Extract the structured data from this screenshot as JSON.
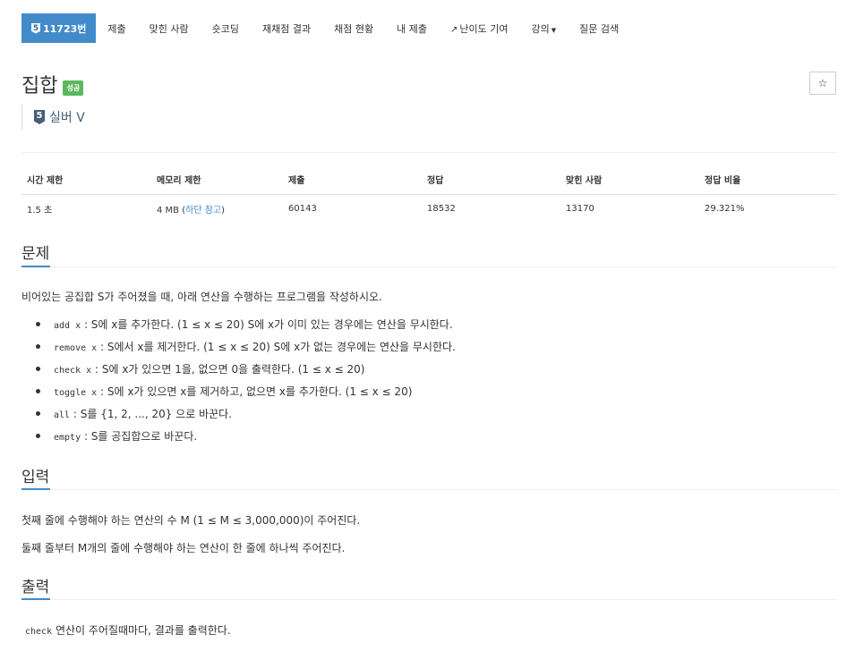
{
  "nav": {
    "problem_id": "11723번",
    "items": [
      "제출",
      "맞힌 사람",
      "숏코딩",
      "재채점 결과",
      "채점 현황",
      "내 제출",
      "난이도 기여",
      "강의",
      "질문 검색"
    ]
  },
  "problem": {
    "title": "집합",
    "status_badge": "성공",
    "tier": "실버 V",
    "tier_number": "5",
    "star": "☆"
  },
  "info_table": {
    "headers": [
      "시간 제한",
      "메모리 제한",
      "제출",
      "정답",
      "맞힌 사람",
      "정답 비율"
    ],
    "time_limit": "1.5 초",
    "memory_limit": "4 MB",
    "memory_note": "하단 참고",
    "submissions": "60143",
    "accepted": "18532",
    "solvers": "13170",
    "ratio": "29.321%"
  },
  "sections": {
    "description_title": "문제",
    "description_intro": "비어있는 공집합 S가 주어졌을 때, 아래 연산을 수행하는 프로그램을 작성하시오.",
    "operations": [
      {
        "code": "add x",
        "text": ": S에 x를 추가한다. (1 ≤ x ≤ 20) S에 x가 이미 있는 경우에는 연산을 무시한다."
      },
      {
        "code": "remove x",
        "text": ": S에서 x를 제거한다. (1 ≤ x ≤ 20) S에 x가 없는 경우에는 연산을 무시한다."
      },
      {
        "code": "check x",
        "text": ": S에 x가 있으면 1을, 없으면 0을 출력한다. (1 ≤ x ≤ 20)"
      },
      {
        "code": "toggle x",
        "text": ": S에 x가 있으면 x를 제거하고, 없으면 x를 추가한다. (1 ≤ x ≤ 20)"
      },
      {
        "code": "all",
        "text": ": S를 {1, 2, ..., 20} 으로 바꾼다."
      },
      {
        "code": "empty",
        "text": ": S를 공집합으로 바꾼다."
      }
    ],
    "input_title": "입력",
    "input_line1": "첫째 줄에 수행해야 하는 연산의 수 M (1 ≤ M ≤ 3,000,000)이 주어진다.",
    "input_line2": "둘째 줄부터 M개의 줄에 수행해야 하는 연산이 한 줄에 하나씩 주어진다.",
    "output_title": "출력",
    "output_code": "check",
    "output_text": "연산이 주어질때마다, 결과를 출력한다."
  },
  "colors": {
    "primary": "#428bca",
    "success": "#5cb85c",
    "silver": "#435f7a"
  },
  "icons": [
    "tier-badge-icon",
    "external-link-icon",
    "caret-down-icon",
    "star-icon",
    "bullet-icon"
  ]
}
